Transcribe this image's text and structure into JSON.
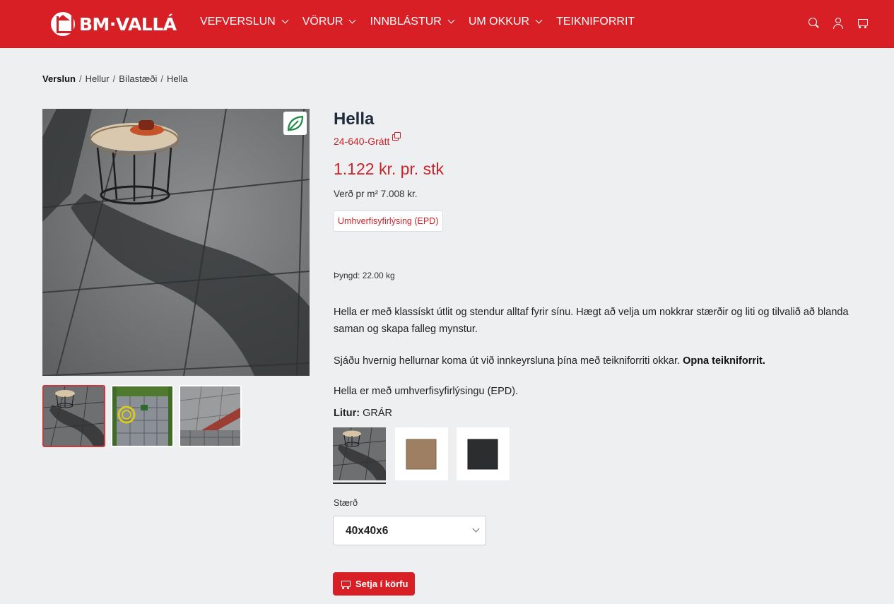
{
  "header": {
    "logo_text": "BM·VALLÁ",
    "nav": [
      {
        "label": "VEFVERSLUN",
        "has_dropdown": true
      },
      {
        "label": "VÖRUR",
        "has_dropdown": true
      },
      {
        "label": "INNBLÁSTUR",
        "has_dropdown": true
      },
      {
        "label": "UM OKKUR",
        "has_dropdown": true
      },
      {
        "label": "TEIKNIFORRIT",
        "has_dropdown": false
      }
    ],
    "icons": [
      "search-icon",
      "user-icon",
      "cart-icon"
    ],
    "brand_color": "#d81f26"
  },
  "breadcrumb": [
    "Verslun",
    "Hellur",
    "Bílastæði",
    "Hella"
  ],
  "gallery": {
    "badge_icon": "leaf-icon",
    "thumbnails": [
      "table-on-paving",
      "garden-hose-on-paving",
      "paving-with-red-border"
    ],
    "active_thumbnail": 0
  },
  "product": {
    "title": "Hella",
    "sku": "24-640-Grátt",
    "price": "1.122 kr. pr. stk",
    "price_per_m2": "Verð pr m² 7.008 kr.",
    "epd_button": "Umhverfisyfirlýsing (EPD)",
    "weight": "Þyngd: 22.00 kg",
    "description": "Hella er með klassískt útlit og stendur alltaf fyrir sínu. Hægt að velja um nokkrar stærðir og liti og tilvalið að blanda saman og skapa falleg mynstur.",
    "planner_text": "Sjáðu hvernig hellurnar koma út við innkeyrsluna þína með teikniforriti okkar.",
    "planner_link": "Opna teikniforrit.",
    "epd_text": "Hella er með umhverfisyfirlýsingu (EPD).",
    "color_label": "Litur:",
    "color_value": "GRÁR",
    "swatches": [
      {
        "name": "grár",
        "selected": true
      },
      {
        "name": "brown",
        "selected": false
      },
      {
        "name": "black",
        "selected": false
      }
    ],
    "size_label": "Stærð",
    "size_value": "40x40x6",
    "add_to_cart": "Setja í körfu"
  }
}
